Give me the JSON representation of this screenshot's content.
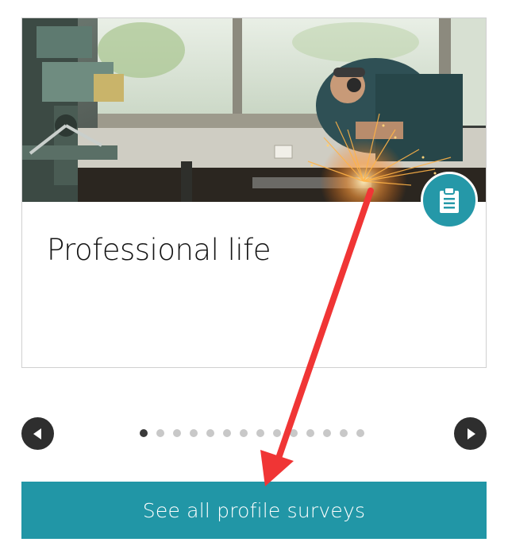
{
  "card": {
    "title": "Professional life",
    "image_description": "workshop-grinding-photo",
    "badge_icon": "clipboard-icon",
    "badge_color": "#2598a8"
  },
  "carousel": {
    "prev_icon": "chevron-left-icon",
    "next_icon": "chevron-right-icon",
    "total_pages": 14,
    "active_page": 1
  },
  "cta": {
    "label": "See all profile surveys",
    "color": "#2196a6"
  },
  "annotation": {
    "color": "#f03535"
  }
}
